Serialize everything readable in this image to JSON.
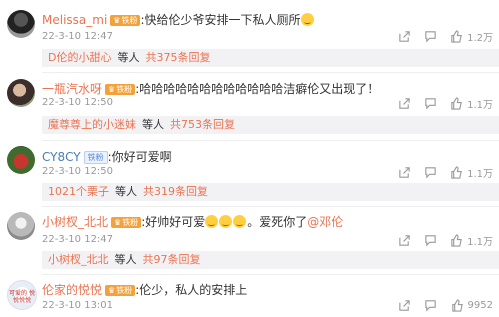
{
  "comments": [
    {
      "user": "Melissa_mi",
      "badge": "铁粉",
      "text": ":快给伦少爷安排一下私人厕所",
      "time": "22-3-10 12:47",
      "likes": "1.2万",
      "reply": {
        "name": "D伦的小甜心",
        "mid": "等人",
        "link": "共375条回复"
      }
    },
    {
      "user": "一瓶汽水呀",
      "badge": "铁粉",
      "text": ":哈哈哈哈哈哈哈哈哈哈哈哈洁癖伦又出现了！",
      "time": "22-3-10 12:50",
      "likes": "1.1万",
      "reply": {
        "name": "魔尊尊上的小迷妹",
        "mid": "等人",
        "link": "共753条回复"
      }
    },
    {
      "user": "CY8CY",
      "badge": "铁粉",
      "text": ":你好可爱啊",
      "time": "22-3-10 12:50",
      "likes": "1.1万",
      "reply": {
        "name": "1021个栗子",
        "mid": "等人",
        "link": "共319条回复"
      }
    },
    {
      "user": "小树杈_北北",
      "badge": "铁粉",
      "text_before": ":好帅好可爱",
      "text_after": "。爱死你了",
      "mention": "@邓伦",
      "time": "22-3-10 12:47",
      "likes": "1.1万",
      "reply": {
        "name": "小树杈_北北",
        "mid": "等人",
        "link": "共97条回复"
      }
    },
    {
      "user": "伦家的悦悦",
      "badge": "铁粉",
      "avatar_text": "可爱的 悦悦悦悦",
      "text": ":伦少，私人的安排上",
      "time": "22-3-10 13:01",
      "likes": "9952"
    }
  ],
  "icons": {
    "share": "share-icon",
    "comment": "comment-icon",
    "like": "thumbs-up-icon",
    "emoji": "grinning-emoji-icon"
  },
  "colors": {
    "username": "#eb7350",
    "verified_user": "#4a7db8",
    "badge_gold": "#f3a23b",
    "reply_bg": "#f2f2f5",
    "meta": "#999999"
  }
}
